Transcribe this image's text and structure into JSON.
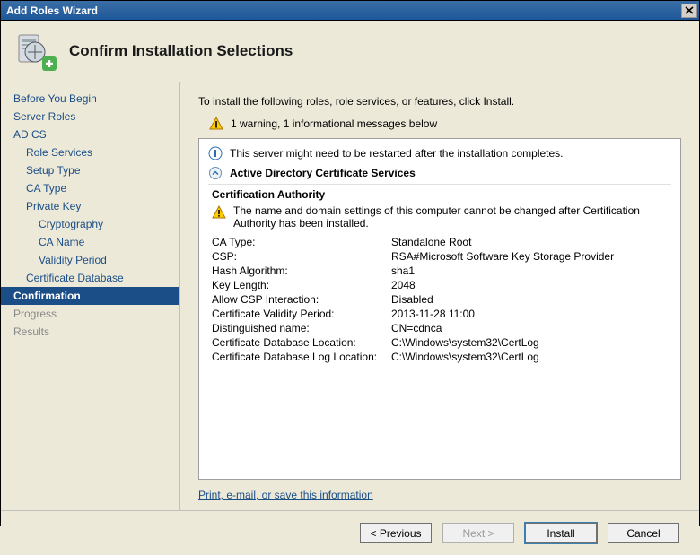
{
  "window": {
    "title": "Add Roles Wizard"
  },
  "header": {
    "title": "Confirm Installation Selections"
  },
  "sidebar": {
    "items": [
      {
        "label": "Before You Begin",
        "level": 0
      },
      {
        "label": "Server Roles",
        "level": 0
      },
      {
        "label": "AD CS",
        "level": 0
      },
      {
        "label": "Role Services",
        "level": 1
      },
      {
        "label": "Setup Type",
        "level": 1
      },
      {
        "label": "CA Type",
        "level": 1
      },
      {
        "label": "Private Key",
        "level": 1
      },
      {
        "label": "Cryptography",
        "level": 2
      },
      {
        "label": "CA Name",
        "level": 2
      },
      {
        "label": "Validity Period",
        "level": 2
      },
      {
        "label": "Certificate Database",
        "level": 1
      },
      {
        "label": "Confirmation",
        "level": 0,
        "selected": true
      },
      {
        "label": "Progress",
        "level": 0,
        "disabled": true
      },
      {
        "label": "Results",
        "level": 0,
        "disabled": true
      }
    ]
  },
  "content": {
    "instruction": "To install the following roles, role services, or features, click Install.",
    "messages_summary": "1 warning, 1 informational messages below",
    "info_message": "This server might need to be restarted after the installation completes.",
    "section_title": "Active Directory Certificate Services",
    "subheading": "Certification Authority",
    "warning": "The name and domain settings of this computer cannot be changed after Certification Authority has been installed.",
    "details": [
      {
        "k": "CA Type:",
        "v": "Standalone Root"
      },
      {
        "k": "CSP:",
        "v": "RSA#Microsoft Software Key Storage Provider"
      },
      {
        "k": "Hash Algorithm:",
        "v": "sha1"
      },
      {
        "k": "Key Length:",
        "v": "2048"
      },
      {
        "k": "Allow CSP Interaction:",
        "v": "Disabled"
      },
      {
        "k": "Certificate Validity Period:",
        "v": "2013-11-28 11:00"
      },
      {
        "k": "Distinguished name:",
        "v": "CN=cdnca"
      },
      {
        "k": "Certificate Database Location:",
        "v": "C:\\Windows\\system32\\CertLog"
      },
      {
        "k": "Certificate Database Log Location:",
        "v": "C:\\Windows\\system32\\CertLog"
      }
    ],
    "link": "Print, e-mail, or save this information"
  },
  "footer": {
    "previous": "< Previous",
    "next": "Next >",
    "install": "Install",
    "cancel": "Cancel"
  }
}
